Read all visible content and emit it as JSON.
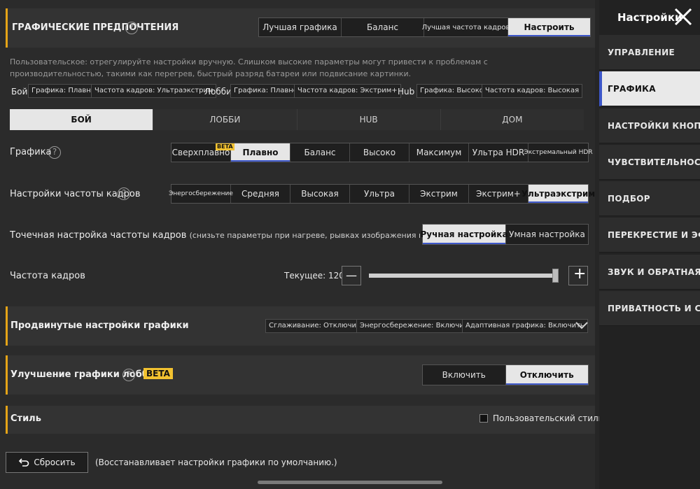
{
  "sidebar": {
    "title": "Настройки",
    "items": [
      {
        "label": "УПРАВЛЕНИЕ"
      },
      {
        "label": "ГРАФИКА"
      },
      {
        "label": "НАСТРОЙКИ КНОПОК"
      },
      {
        "label": "ЧУВСТВИТЕЛЬНОСТЬ"
      },
      {
        "label": "ПОДБОР"
      },
      {
        "label": "ПЕРЕКРЕСТИЕ И ЭФФЕКТЫ"
      },
      {
        "label": "ЗВУК И ОБРАТНАЯ СВЯЗЬ"
      },
      {
        "label": "ПРИВАТНОСТЬ И СОЦПЛАТФОРМЫ"
      }
    ]
  },
  "prefs": {
    "title": "ГРАФИЧЕСКИЕ ПРЕДПОЧТЕНИЯ",
    "options": [
      "Лучшая графика",
      "Баланс",
      "Лучшая частота кадров",
      "Настроить"
    ],
    "description": "Пользовательское: отрегулируйте настройки вручную. Слишком высокие параметры могут привести к проблемам с производительностью, такими как перегрев, быстрый разряд батареи или подвисание картинки.",
    "summary": {
      "battle_label": "Бой",
      "battle_graphics": "Графика: Плавно",
      "battle_fps": "Частота кадров: Ультраэкстрим",
      "lobby_label": "Лобби",
      "lobby_graphics": "Графика: Плавно",
      "lobby_fps": "Частота кадров: Экстрим+",
      "hub_label": "Hub",
      "hub_graphics": "Графика: Высоко",
      "hub_fps": "Частота кадров: Высокая"
    }
  },
  "mode_tabs": [
    "БОЙ",
    "ЛОББИ",
    "HUB",
    "ДОМ"
  ],
  "graphics": {
    "label": "Графика",
    "beta": "BETA",
    "options": [
      "Сверхплавно",
      "Плавно",
      "Баланс",
      "Высоко",
      "Максимум",
      "Ультра HDR",
      "Экстремальный HDR"
    ]
  },
  "fps": {
    "label": "Настройки частоты кадров",
    "options": [
      "Энергосбережение",
      "Средняя",
      "Высокая",
      "Ультра",
      "Экстрим",
      "Экстрим+",
      "Ультраэкстрим"
    ]
  },
  "fine_fps": {
    "label": "Точечная настройка частоты кадров",
    "hint": "(снизьте параметры при нагреве, рывках изображения или быстром расходе батареи)",
    "options": [
      "Ручная настройка",
      "Умная настройка"
    ]
  },
  "frame_rate": {
    "label": "Частота кадров",
    "current_label": "Текущее: 120",
    "minus": "—",
    "plus": "+",
    "level": 1.0
  },
  "advanced": {
    "title": "Продвинутые настройки графики",
    "tags": [
      "Сглаживание: Отключить",
      "Энергосбережение: Включить",
      "Адаптивная графика: Включить"
    ]
  },
  "lobby_enhance": {
    "title": "Улучшение графики лобби",
    "beta": "BETA",
    "options": [
      "Включить",
      "Отключить"
    ]
  },
  "style": {
    "title": "Стиль",
    "custom_label": "Пользовательский стиль"
  },
  "footer": {
    "reset_label": "Сбросить",
    "reset_hint": "(Восстанавливает настройки графики по умолчанию.)"
  },
  "colors": {
    "accent": "#e5a417",
    "active_underline": "#3d57c9",
    "beta": "#f2c230"
  }
}
